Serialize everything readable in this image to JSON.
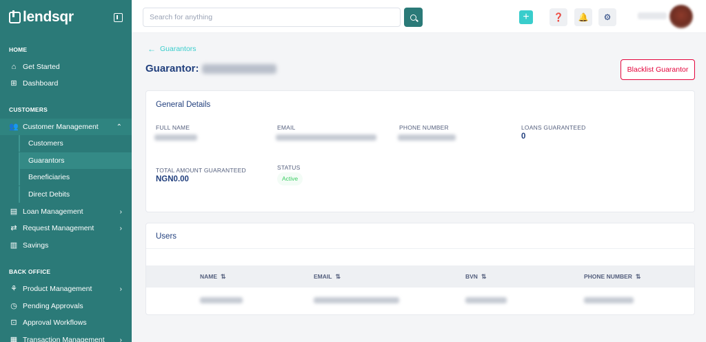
{
  "app": {
    "logo_text": "lendsqr"
  },
  "sidebar": {
    "sections": [
      {
        "title": "HOME"
      },
      {
        "title": "CUSTOMERS"
      },
      {
        "title": "BACK OFFICE"
      }
    ],
    "items": [
      {
        "label": "Get Started"
      },
      {
        "label": "Dashboard"
      },
      {
        "label": "Customer Management"
      },
      {
        "label": "Customers"
      },
      {
        "label": "Guarantors"
      },
      {
        "label": "Beneficiaries"
      },
      {
        "label": "Direct Debits"
      },
      {
        "label": "Loan Management"
      },
      {
        "label": "Request Management"
      },
      {
        "label": "Savings"
      },
      {
        "label": "Product Management"
      },
      {
        "label": "Pending Approvals"
      },
      {
        "label": "Approval Workflows"
      },
      {
        "label": "Transaction Management"
      }
    ]
  },
  "topbar": {
    "search_placeholder": "Search for anything",
    "plus_label": "+"
  },
  "breadcrumb": {
    "back_label": "Guarantors"
  },
  "page": {
    "title_prefix": "Guarantor:",
    "blacklist_label": "Blacklist Guarantor"
  },
  "details": {
    "heading": "General Details",
    "fields": [
      {
        "label": "FULL NAME"
      },
      {
        "label": "EMAIL"
      },
      {
        "label": "PHONE NUMBER"
      },
      {
        "label": "LOANS GUARANTEED",
        "value": "0"
      },
      {
        "label": "TOTAL AMOUNT GUARANTEED",
        "value": "NGN0.00"
      },
      {
        "label": "STATUS",
        "value": "Active"
      }
    ]
  },
  "users": {
    "heading": "Users",
    "columns": [
      "NAME",
      "EMAIL",
      "BVN",
      "PHONE NUMBER"
    ]
  },
  "colors": {
    "sidebar_bg": "#2b7a78",
    "accent": "#39cdcc",
    "title": "#213f7d",
    "danger": "#e4033b",
    "success": "#39cd62"
  }
}
